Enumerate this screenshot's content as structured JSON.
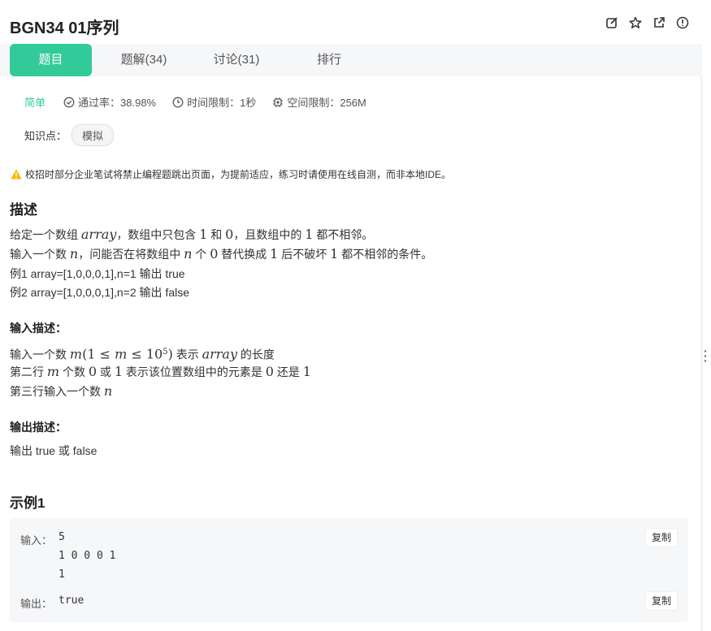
{
  "header": {
    "title": "BGN34  01序列",
    "icons": [
      "edit-icon",
      "star-icon",
      "share-icon",
      "info-icon"
    ]
  },
  "tabs": [
    {
      "label": "题目",
      "active": true
    },
    {
      "label": "题解(34)",
      "active": false
    },
    {
      "label": "讨论(31)",
      "active": false
    },
    {
      "label": "排行",
      "active": false
    }
  ],
  "meta": {
    "difficulty": "简单",
    "pass_rate": "通过率：38.98%",
    "time_limit": "时间限制：1秒",
    "space_limit": "空间限制：256M"
  },
  "knowledge": {
    "label": "知识点：",
    "tag": "模拟"
  },
  "warning": "校招时部分企业笔试将禁止编程题跳出页面，为提前适应，练习时请使用在线自测，而非本地IDE。",
  "description": {
    "title": "描述",
    "line1": {
      "a": "给定一个数组 ",
      "var": "array",
      "b": "，数组中只包含 ",
      "one": "1",
      "c": " 和 ",
      "zero": "0",
      "d": "，且数组中的 ",
      "one2": "1",
      "e": " 都不相邻。"
    },
    "line2": {
      "a": "输入一个数 ",
      "var": "n",
      "b": "，问能否在将数组中 ",
      "var2": "n",
      "c": " 个 ",
      "zero": "0",
      "d": " 替代换成 ",
      "one": "1",
      "e": " 后不破坏 ",
      "one2": "1",
      "f": " 都不相邻的条件。"
    },
    "example1": "例1 array=[1,0,0,0,1],n=1 输出 true",
    "example2": "例2 array=[1,0,0,0,1],n=2 输出 false"
  },
  "input_desc": {
    "title": "输入描述：",
    "line1": {
      "a": "输入一个数 ",
      "m": "m",
      "open": "(",
      "one": "1",
      "le": " ≤ ",
      "m2": "m",
      "le2": " ≤ ",
      "ten": "10",
      "exp": "5",
      "close": ")",
      "b": " 表示 ",
      "var": "array",
      "c": " 的长度"
    },
    "line2": {
      "a": "第二行 ",
      "m": "m",
      "b": " 个数 ",
      "zero": "0",
      "c": " 或 ",
      "one": "1",
      "d": " 表示该位置数组中的元素是 ",
      "zero2": "0",
      "e": " 还是 ",
      "one2": "1"
    },
    "line3": {
      "a": "第三行输入一个数 ",
      "n": "n"
    }
  },
  "output_desc": {
    "title": "输出描述：",
    "text": "输出 true 或 false"
  },
  "example": {
    "title": "示例1",
    "input_label": "输入：",
    "input_value": "5\n1 0 0 0 1\n1",
    "output_label": "输出：",
    "output_value": "true",
    "copy_label": "复制"
  }
}
